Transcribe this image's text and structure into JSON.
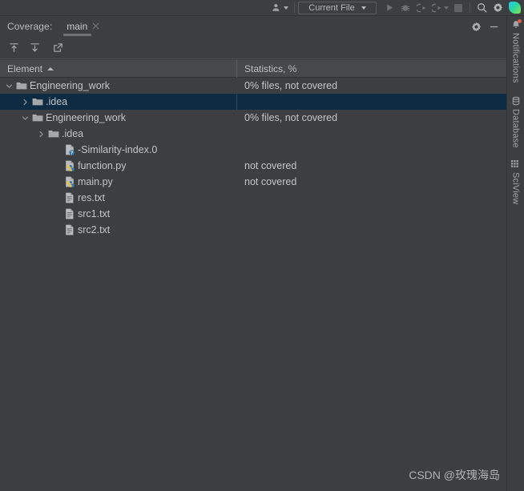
{
  "colors": {
    "background": "#3c3f41",
    "header_background": "#45494a",
    "selection": "#0d2b42",
    "text": "#c2c5c6",
    "muted_text": "#a3a6a8",
    "disabled_icon": "#6e7173",
    "notification_dot": "#e05c4a",
    "folder_icon": "#a3a7aa",
    "python_icon_blue": "#3c78a8",
    "python_icon_yellow": "#e8c44a"
  },
  "ide_toolbar": {
    "run_config": {
      "label": "Current File",
      "dropdown_icon": "chevron-down-icon"
    },
    "icons": [
      {
        "name": "user-account-icon",
        "state": "enabled"
      },
      {
        "name": "run-icon",
        "state": "disabled"
      },
      {
        "name": "debug-icon",
        "state": "disabled"
      },
      {
        "name": "run-with-coverage-icon",
        "state": "disabled"
      },
      {
        "name": "profile-icon",
        "state": "disabled"
      },
      {
        "name": "stop-icon",
        "state": "disabled"
      },
      {
        "name": "search-icon",
        "state": "enabled"
      },
      {
        "name": "settings-gear-icon",
        "state": "enabled"
      },
      {
        "name": "ide-logo-icon",
        "state": "enabled"
      }
    ]
  },
  "coverage_panel": {
    "title": "Coverage:",
    "tab": {
      "name": "main",
      "close_icon": "close-icon"
    },
    "header_buttons": [
      {
        "name": "settings-gear-icon",
        "label": ""
      },
      {
        "name": "minimize-icon",
        "label": ""
      }
    ],
    "actions": [
      {
        "name": "collapse-all-icon",
        "label": ""
      },
      {
        "name": "expand-all-icon",
        "label": ""
      },
      {
        "name": "export-icon",
        "label": ""
      }
    ],
    "columns": [
      {
        "key": "element",
        "label": "Element",
        "sort": "asc"
      },
      {
        "key": "statistics",
        "label": "Statistics, %",
        "sort": "none"
      }
    ],
    "rows": [
      {
        "label": "Engineering_work",
        "statistics": "0% files, not covered",
        "icon": "folder-icon",
        "depth": 0,
        "twisty": "expanded",
        "selected": false
      },
      {
        "label": ".idea",
        "statistics": "",
        "icon": "folder-icon",
        "depth": 1,
        "twisty": "collapsed",
        "selected": true
      },
      {
        "label": "Engineering_work",
        "statistics": "0% files, not covered",
        "icon": "folder-icon",
        "depth": 1,
        "twisty": "expanded",
        "selected": false
      },
      {
        "label": ".idea",
        "statistics": "",
        "icon": "folder-icon",
        "depth": 2,
        "twisty": "collapsed",
        "selected": false
      },
      {
        "label": "-Similarity-index.0",
        "statistics": "",
        "icon": "python-unknown-file-icon",
        "depth": 3,
        "twisty": "none",
        "selected": false
      },
      {
        "label": "function.py",
        "statistics": "not covered",
        "icon": "python-file-icon",
        "depth": 3,
        "twisty": "none",
        "selected": false
      },
      {
        "label": "main.py",
        "statistics": "not covered",
        "icon": "python-file-icon",
        "depth": 3,
        "twisty": "none",
        "selected": false
      },
      {
        "label": "res.txt",
        "statistics": "",
        "icon": "text-file-icon",
        "depth": 3,
        "twisty": "none",
        "selected": false
      },
      {
        "label": "src1.txt",
        "statistics": "",
        "icon": "text-file-icon",
        "depth": 3,
        "twisty": "none",
        "selected": false
      },
      {
        "label": "src2.txt",
        "statistics": "",
        "icon": "text-file-icon",
        "depth": 3,
        "twisty": "none",
        "selected": false
      }
    ]
  },
  "right_strip": {
    "items": [
      {
        "label": "Notifications",
        "icon": "bell-icon",
        "badge": true
      },
      {
        "label": "Database",
        "icon": "database-icon",
        "badge": false
      },
      {
        "label": "SciView",
        "icon": "grid-icon",
        "badge": false
      }
    ]
  },
  "watermark": {
    "text": "CSDN @玫瑰海岛"
  }
}
